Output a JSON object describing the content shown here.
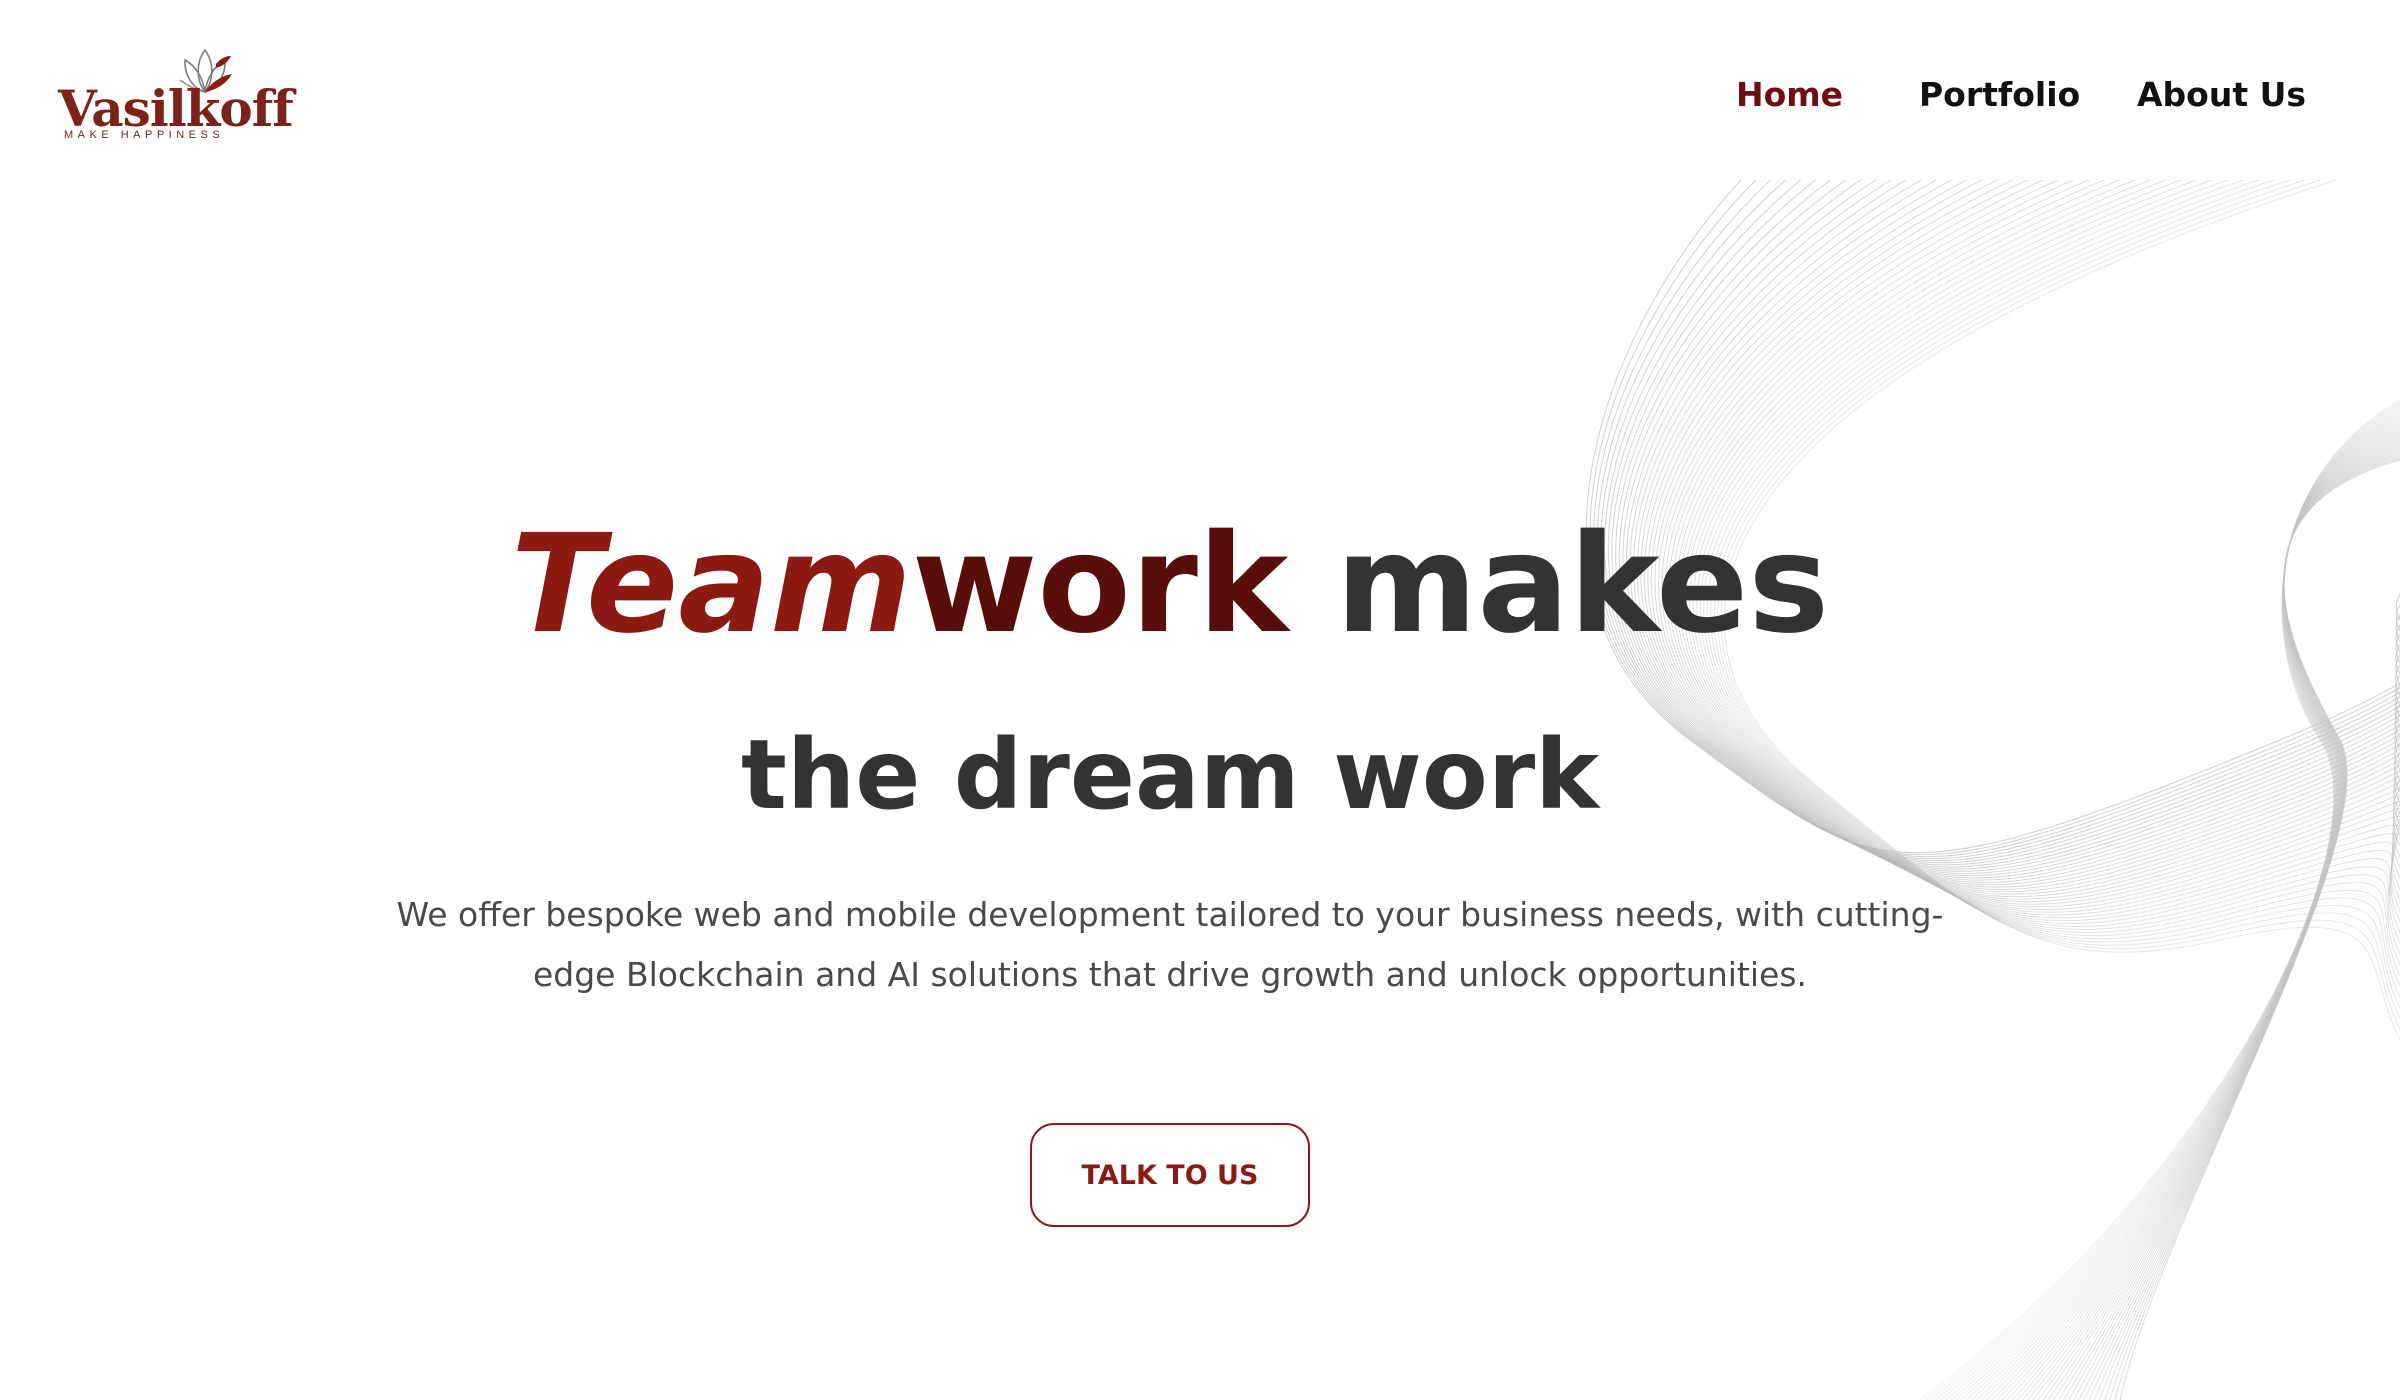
{
  "brand": {
    "name": "Vasilkoff",
    "tagline": "MAKE HAPPINESS",
    "color": "#7d2218",
    "icon": "lotus-flower-icon"
  },
  "nav": {
    "items": [
      {
        "label": "Home",
        "active": true
      },
      {
        "label": "Portfolio",
        "active": false
      },
      {
        "label": "About Us",
        "active": false
      }
    ],
    "active_color": "#6e0f0f"
  },
  "hero": {
    "headline_part1": "Team",
    "headline_part2": "work",
    "headline_part3": "makes",
    "headline_line2": "the dream work",
    "description": "We offer bespoke web and mobile development tailored to your business needs, with cutting-edge Blockchain and AI solutions that drive growth and unlock opportunities.",
    "cta_label": "TALK TO US",
    "accent_color": "#8c1a13",
    "text_color": "#333333"
  },
  "background": {
    "decoration": "flowing-line-wave"
  }
}
